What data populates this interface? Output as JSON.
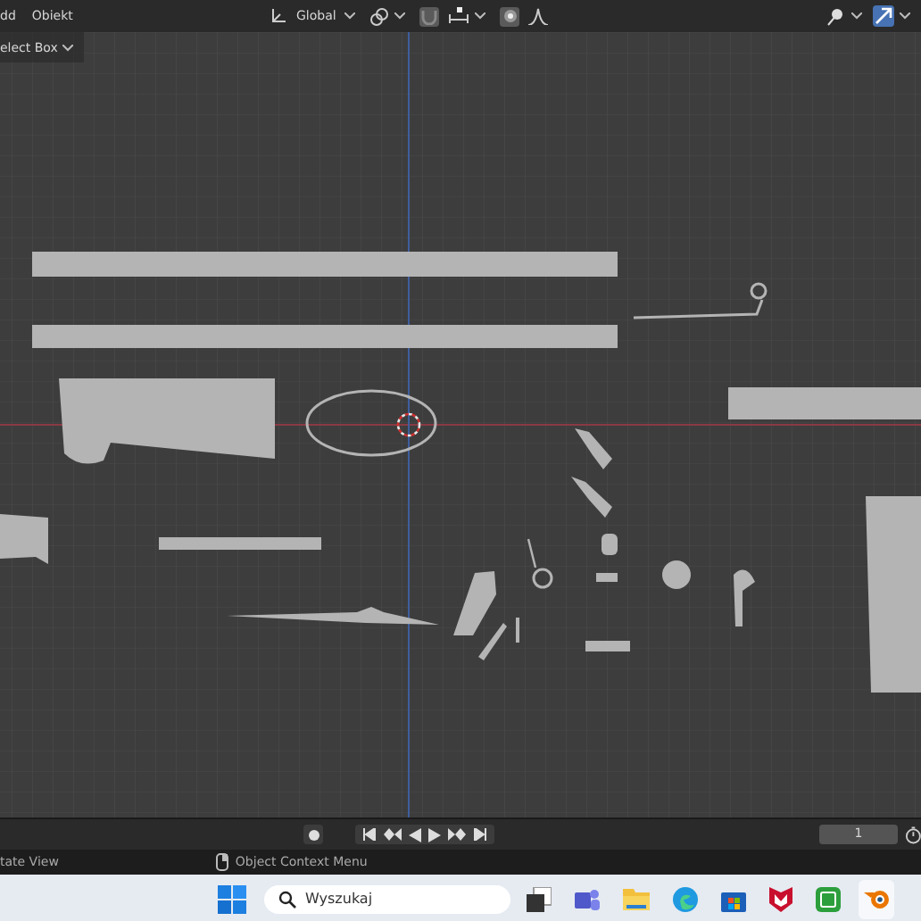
{
  "header": {
    "menus": [
      {
        "label": "dd"
      },
      {
        "label": "Obiekt"
      }
    ],
    "orientation": "Global"
  },
  "tool_settings": {
    "select_mode": "elect Box"
  },
  "timeline": {
    "frame": "1"
  },
  "status_bar": {
    "items": [
      {
        "label": "tate View"
      },
      {
        "label": "Object Context Menu"
      }
    ]
  },
  "taskbar": {
    "search": {
      "placeholder": "Wyszukaj"
    }
  }
}
